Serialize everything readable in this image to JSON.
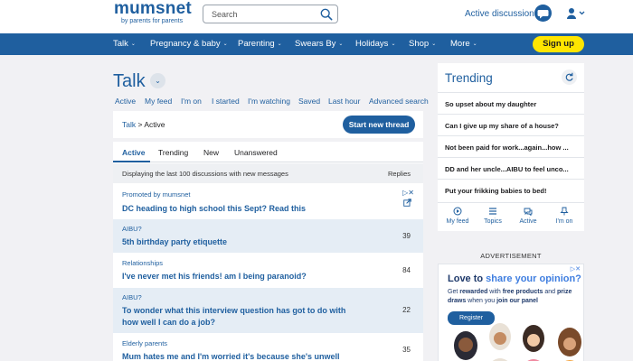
{
  "header": {
    "logo_name": "mumsnet",
    "logo_tagline": "by parents for parents",
    "search_placeholder": "Search",
    "active_discussions": "Active discussions"
  },
  "nav": {
    "items": [
      "Talk",
      "Pregnancy & baby",
      "Parenting",
      "Swears By",
      "Holidays",
      "Shop",
      "More"
    ],
    "signup": "Sign up"
  },
  "talk": {
    "title": "Talk",
    "subnav": [
      "Active",
      "My feed",
      "I'm on",
      "I started",
      "I'm watching",
      "Saved",
      "Last hour",
      "Advanced search"
    ],
    "breadcrumb_root": "Talk",
    "breadcrumb_sep": ">",
    "breadcrumb_current": "Active",
    "new_thread": "Start new thread"
  },
  "list": {
    "tabs": [
      "Active",
      "Trending",
      "New",
      "Unanswered"
    ],
    "displaying": "Displaying the last 100 discussions with new messages",
    "replies_header": "Replies",
    "promoted": {
      "category": "Promoted by mumsnet",
      "title": "DC heading to high school this Sept? Read this",
      "adchoice": "▷✕"
    },
    "threads": [
      {
        "category": "AIBU?",
        "title": "5th birthday party etiquette",
        "replies": "39"
      },
      {
        "category": "Relationships",
        "title": "I've never met his friends! am I being paranoid?",
        "replies": "84"
      },
      {
        "category": "AIBU?",
        "title": "To wonder what this interview question has got to do with how well I can do a job?",
        "replies": "22"
      },
      {
        "category": "Elderly parents",
        "title": "Mum hates me and I'm worried it's because she's unwell",
        "replies": "35"
      }
    ]
  },
  "trending": {
    "title": "Trending",
    "items": [
      "So upset about my daughter",
      "Can I give up my share of a house?",
      "Not been paid for work...again...how ...",
      "DD and her uncle...AIBU to feel unco...",
      "Put your frikking babies to bed!"
    ],
    "footer": [
      "My feed",
      "Topics",
      "Active",
      "I'm on"
    ]
  },
  "ad": {
    "label": "ADVERTISEMENT",
    "headline_pre": "Love to ",
    "headline_hl": "share your opinion?",
    "body_1": "Get ",
    "body_2": "rewarded",
    "body_3": " with ",
    "body_4": "free products",
    "body_5": " and ",
    "body_6": "prize draws",
    "body_7": " when you ",
    "body_8": "join our panel",
    "register": "Register",
    "adchoice": "▷✕"
  },
  "colors": {
    "brand_blue": "#1f5f9f",
    "signup_yellow": "#ffe500",
    "shaded_row": "#e5edf5"
  }
}
